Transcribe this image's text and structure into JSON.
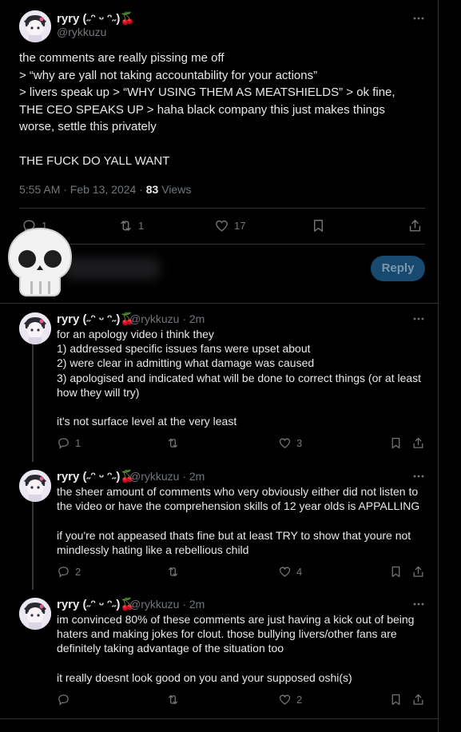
{
  "main_tweet": {
    "display_name": "ryry (˶ᵔ ᵕ ᵔ˶)🍒",
    "handle": "@rykkuzu",
    "text": "the comments are really pissing me off\n> “why are yall not taking accountability for your actions”\n> livers speak up > “WHY USING THEM AS MEATSHIELDS” > ok fine, THE CEO SPEAKS UP > haha black company this just makes things worse, settle this privately\n\nTHE FUCK DO YALL WANT",
    "timestamp": "5:55 AM · Feb 13, 2024 · ",
    "views_count": "83",
    "views_label": " Views",
    "stats": {
      "replies": "1",
      "retweets": "1",
      "likes": "17"
    }
  },
  "reply_box": {
    "button_label": "Reply"
  },
  "replies": [
    {
      "display_name": "ryry (˶ᵔ ᵕ ᵔ˶)🍒",
      "handle": "@rykkuzu · 2m",
      "text": "for an apology video i think they\n1) addressed specific issues fans were upset about\n2) were clear in admitting what damage was caused\n3) apologised and indicated what will be done to correct things (or at least how they will try)\n\nit's not surface level at the very least",
      "replies": "1",
      "retweets": "",
      "likes": "3"
    },
    {
      "display_name": "ryry (˶ᵔ ᵕ ᵔ˶)🍒",
      "handle": "@rykkuzu · 2m",
      "text": "the sheer amount of comments who very obviously either did not listen to the video or have the comprehension skills of 12 year olds is APPALLING\n\nif you're not appeased thats fine but at least TRY to show that youre not mindlessly hating like a rebellious child",
      "replies": "2",
      "retweets": "",
      "likes": "4"
    },
    {
      "display_name": "ryry (˶ᵔ ᵕ ᵔ˶)🍒",
      "handle": "@rykkuzu · 2m",
      "text": "im convinced 80% of these comments are just having a kick out of being haters and making jokes for clout. those bullying livers/other fans are definitely taking advantage of the situation too\n\nit really doesnt look good on you and your supposed oshi(s)",
      "replies": "",
      "retweets": "",
      "likes": "2"
    }
  ],
  "colors": {
    "background": "#000000",
    "text": "#e7e9ea",
    "muted": "#71767b",
    "border": "#2f3336",
    "reply_button": "#174a6e"
  }
}
